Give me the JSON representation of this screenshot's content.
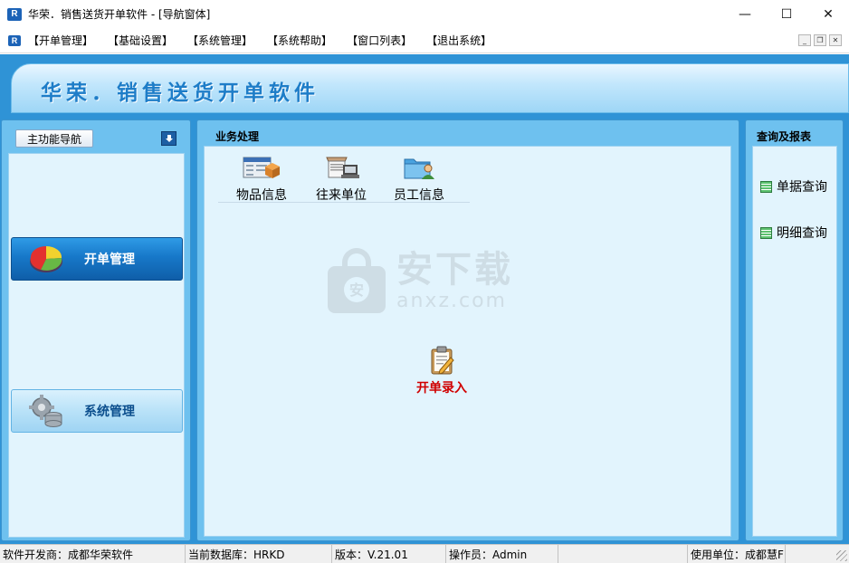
{
  "window": {
    "title": "华荣．销售送货开单软件 - [导航窗体]",
    "logo_text": "R",
    "controls": {
      "minimize": "—",
      "maximize": "☐",
      "close": "✕"
    }
  },
  "menubar": {
    "items": [
      "【开单管理】",
      "【基础设置】",
      "【系统管理】",
      "【系统帮助】",
      "【窗口列表】",
      "【退出系统】"
    ],
    "mdi_controls": {
      "minimize": "_",
      "restore": "❐",
      "close": "✕"
    }
  },
  "banner": {
    "title": "华荣．销售送货开单软件"
  },
  "left_panel": {
    "header_label": "主功能导航",
    "buttons": [
      {
        "label": "开单管理",
        "icon": "pie-chart-icon"
      },
      {
        "label": "系统管理",
        "icon": "gear-database-icon"
      }
    ]
  },
  "center_panel": {
    "header": "业务处理",
    "tools": [
      {
        "label": "物品信息",
        "icon": "goods-info-icon"
      },
      {
        "label": "往来单位",
        "icon": "partner-unit-icon"
      },
      {
        "label": "员工信息",
        "icon": "employee-info-icon"
      }
    ],
    "entry": {
      "label": "开单录入",
      "icon": "clipboard-edit-icon"
    },
    "watermark": {
      "big": "安下载",
      "small": "anxz.com",
      "shield": "安"
    }
  },
  "right_panel": {
    "header": "查询及报表",
    "items": [
      {
        "label": "单据查询",
        "icon": "report-list-icon"
      },
      {
        "label": "明细查询",
        "icon": "report-list-icon"
      }
    ]
  },
  "statusbar": {
    "developer": "软件开发商：成都华荣软件",
    "database": "当前数据库：HRKD",
    "version": "版本：V.21.01",
    "operator": "操作员：Admin",
    "unit": "使用单位：成都慧F"
  },
  "colors": {
    "main_bg": "#2f93d6",
    "panel_bg": "#6ec1ef",
    "inner_bg": "#e2f4fd",
    "accent_blue": "#1778c9",
    "entry_red": "#d00000"
  }
}
